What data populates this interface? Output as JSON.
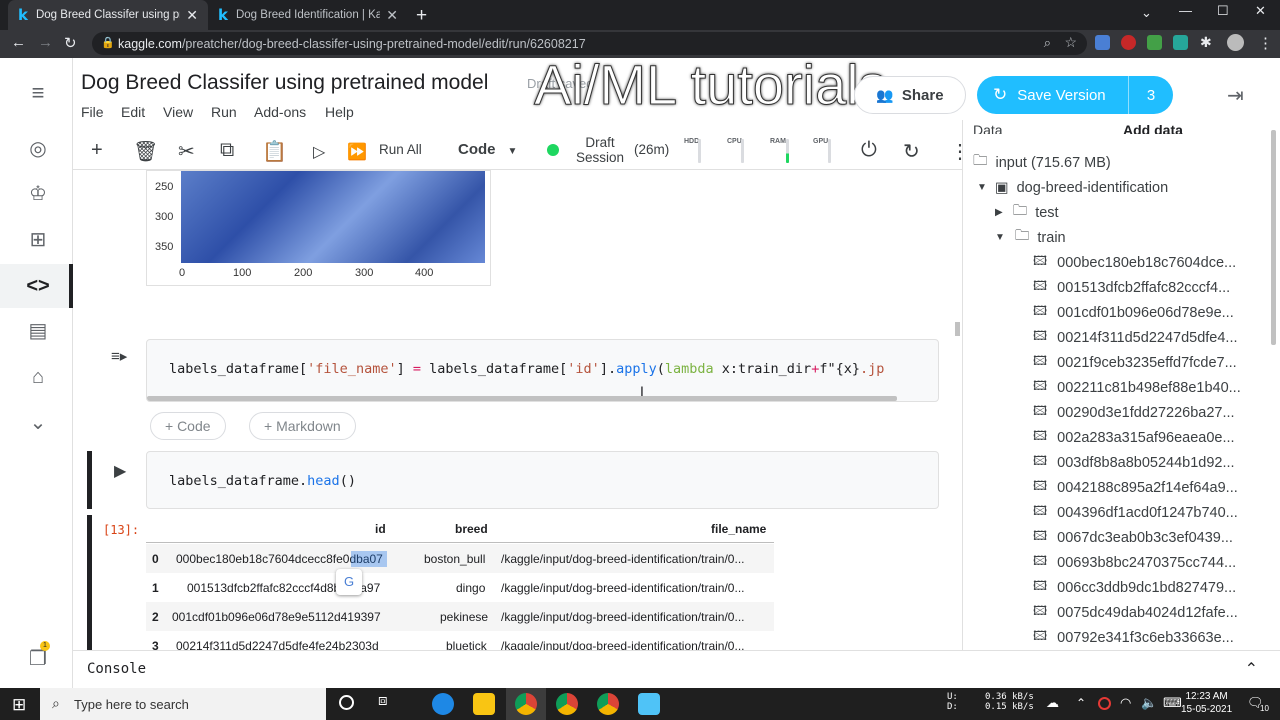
{
  "browser": {
    "tabs": [
      {
        "title": "Dog Breed Classifer using pretrai",
        "active": true
      },
      {
        "title": "Dog Breed Identification | Kaggle",
        "active": false
      }
    ],
    "url_domain": "kaggle.com",
    "url_path": "/preatcher/dog-breed-classifer-using-pretrained-model/edit/run/62608217"
  },
  "header": {
    "title": "Dog Breed Classifer using pretrained model",
    "draft_label": "Draft saved",
    "watermark": "Ai/ML tutorials",
    "share_label": "Share",
    "save_version_label": "Save Version",
    "save_version_count": "3"
  },
  "menu": [
    "File",
    "Edit",
    "View",
    "Run",
    "Add-ons",
    "Help"
  ],
  "toolbar": {
    "run_all": "Run All",
    "cell_type": "Code",
    "session_line1": "Draft",
    "session_line2": "Session",
    "session_time": "(26m)",
    "metrics": [
      "HDD",
      "CPU",
      "RAM",
      "GPU"
    ]
  },
  "plot": {
    "y_ticks": [
      "250",
      "300",
      "350"
    ],
    "x_ticks": [
      "0",
      "100",
      "200",
      "300",
      "400"
    ]
  },
  "cells": {
    "apply_code": {
      "p1": "labels_dataframe[",
      "s1": "'file_name'",
      "p2": "] ",
      "op1": "=",
      "p3": " labels_dataframe[",
      "s2": "'id'",
      "p4": "].",
      "fn1": "apply",
      "p5": "(",
      "kw1": "lambda",
      "p6": " x:train_dir",
      "op2": "+",
      "p7": "f\"{x}",
      "s3": ".jp"
    },
    "add_code": "+ Code",
    "add_markdown": "+ Markdown",
    "head_code": {
      "p1": "labels_dataframe.",
      "fn1": "head",
      "p2": "()"
    },
    "exec_count": "[13]:"
  },
  "table": {
    "columns": [
      "id",
      "breed",
      "file_name"
    ],
    "rows": [
      {
        "idx": "0",
        "id": "000bec180eb18c7604dcecc8fe0dba07",
        "breed": "boston_bull",
        "file": "/kaggle/input/dog-breed-identification/train/0..."
      },
      {
        "idx": "1",
        "id": "001513dfcb2ffafc82cccf4d8bbaba97",
        "breed": "dingo",
        "file": "/kaggle/input/dog-breed-identification/train/0..."
      },
      {
        "idx": "2",
        "id": "001cdf01b096e06d78e9e5112d419397",
        "breed": "pekinese",
        "file": "/kaggle/input/dog-breed-identification/train/0..."
      },
      {
        "idx": "3",
        "id": "00214f311d5d2247d5dfe4fe24b2303d",
        "breed": "bluetick",
        "file": "/kaggle/input/dog-breed-identification/train/0..."
      }
    ]
  },
  "data_panel": {
    "header_left": "Data",
    "header_right": "Add data",
    "input": "input (715.67 MB)",
    "dataset": "dog-breed-identification",
    "folders": [
      "test",
      "train"
    ],
    "files": [
      "000bec180eb18c7604dce...",
      "001513dfcb2ffafc82cccf4...",
      "001cdf01b096e06d78e9e...",
      "00214f311d5d2247d5dfe4...",
      "0021f9ceb3235effd7fcde7...",
      "002211c81b498ef88e1b40...",
      "00290d3e1fdd27226ba27...",
      "002a283a315af96eaea0e...",
      "003df8b8a8b05244b1d92...",
      "0042188c895a2f14ef64a9...",
      "004396df1acd0f1247b740...",
      "0067dc3eab0b3c3ef0439...",
      "00693b8bc2470375cc744...",
      "006cc3ddb9dc1bd827479...",
      "0075dc49dab4024d12fafe...",
      "00792e341f3c6eb33663e..."
    ]
  },
  "console": {
    "label": "Console"
  },
  "taskbar": {
    "search_placeholder": "Type here to search",
    "net_up": "0.36 kB/s",
    "net_down": "0.15 kB/s",
    "drive1": "U:",
    "drive2": "D:",
    "time": "12:23 AM",
    "date": "15-05-2021",
    "notif_count": "10"
  },
  "colors": {
    "kaggle_blue": "#20beff",
    "accent_green": "#1ed760"
  }
}
